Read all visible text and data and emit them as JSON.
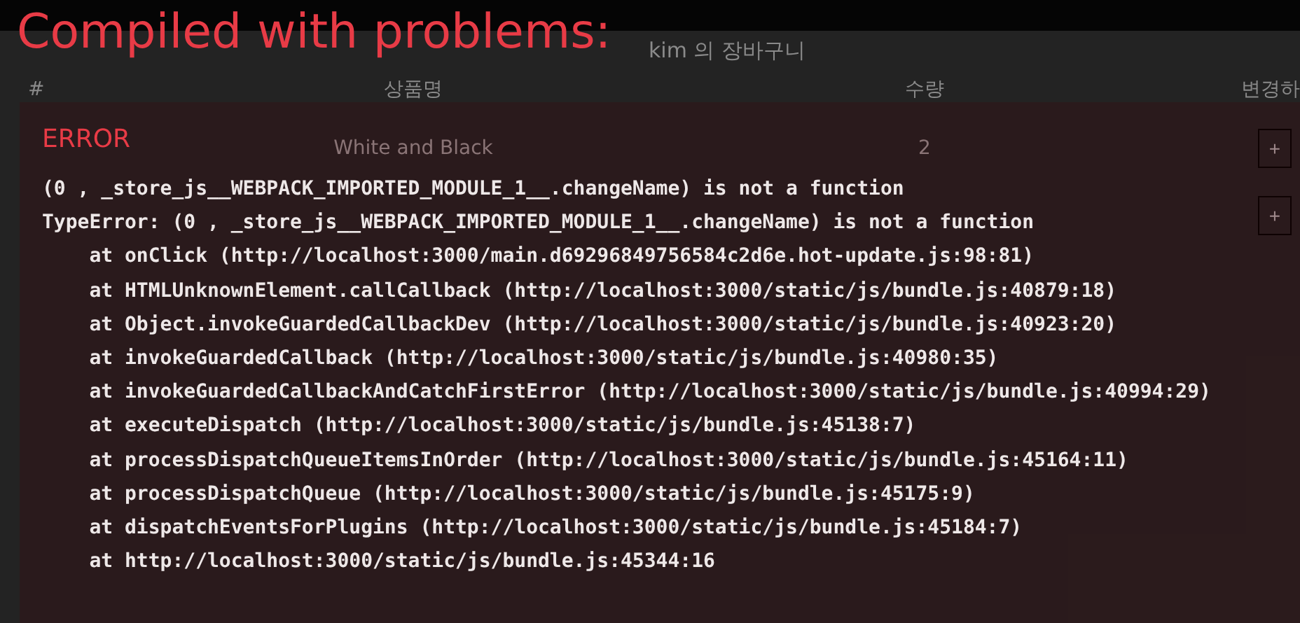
{
  "page": {
    "heading": "kim 의 장바구니",
    "table": {
      "columns": [
        "#",
        "상품명",
        "수량",
        "변경하"
      ],
      "rows": [
        {
          "name": "White and Black",
          "quantity": "2",
          "button": "+"
        },
        {
          "button": "+"
        }
      ]
    }
  },
  "overlay": {
    "title": "Compiled with problems:",
    "error": {
      "label": "ERROR",
      "message": "(0 , _store_js__WEBPACK_IMPORTED_MODULE_1__.changeName) is not a function",
      "stack": [
        "TypeError: (0 , _store_js__WEBPACK_IMPORTED_MODULE_1__.changeName) is not a function",
        "    at onClick (http://localhost:3000/main.d69296849756584c2d6e.hot-update.js:98:81)",
        "    at HTMLUnknownElement.callCallback (http://localhost:3000/static/js/bundle.js:40879:18)",
        "    at Object.invokeGuardedCallbackDev (http://localhost:3000/static/js/bundle.js:40923:20)",
        "    at invokeGuardedCallback (http://localhost:3000/static/js/bundle.js:40980:35)",
        "    at invokeGuardedCallbackAndCatchFirstError (http://localhost:3000/static/js/bundle.js:40994:29)",
        "    at executeDispatch (http://localhost:3000/static/js/bundle.js:45138:7)",
        "    at processDispatchQueueItemsInOrder (http://localhost:3000/static/js/bundle.js:45164:11)",
        "    at processDispatchQueue (http://localhost:3000/static/js/bundle.js:45175:9)",
        "    at dispatchEventsForPlugins (http://localhost:3000/static/js/bundle.js:45184:7)",
        "    at http://localhost:3000/static/js/bundle.js:45344:16"
      ]
    }
  }
}
